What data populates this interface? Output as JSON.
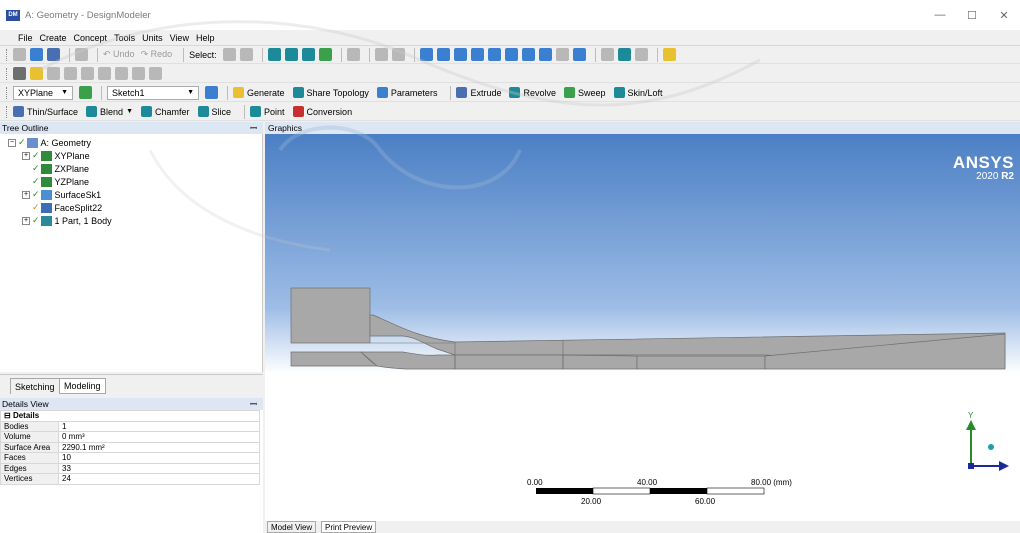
{
  "window": {
    "title": "A: Geometry - DesignModeler",
    "logo_text": "DM",
    "controls": [
      "—",
      "☐",
      "✕"
    ]
  },
  "menu": [
    "File",
    "Create",
    "Concept",
    "Tools",
    "Units",
    "View",
    "Help"
  ],
  "toolbar1": {
    "undo_label": "Undo",
    "redo_label": "Redo",
    "select_label": "Select:"
  },
  "toolbar3": {
    "plane_value": "XYPlane",
    "sketch_value": "Sketch1",
    "generate_label": "Generate",
    "share_topology_label": "Share Topology",
    "parameters_label": "Parameters",
    "extrude_label": "Extrude",
    "revolve_label": "Revolve",
    "sweep_label": "Sweep",
    "skinloft_label": "Skin/Loft"
  },
  "toolbar4": {
    "thinsurface_label": "Thin/Surface",
    "blend_label": "Blend",
    "chamfer_label": "Chamfer",
    "slice_label": "Slice",
    "point_label": "Point",
    "conversion_label": "Conversion"
  },
  "tree": {
    "header": "Tree Outline",
    "pin": "ꟷ",
    "items": [
      {
        "label": "A: Geometry",
        "icon": "geometry-icon"
      },
      {
        "label": "XYPlane",
        "icon": "plane-icon"
      },
      {
        "label": "ZXPlane",
        "icon": "plane-icon"
      },
      {
        "label": "YZPlane",
        "icon": "plane-icon"
      },
      {
        "label": "SurfaceSk1",
        "icon": "surface-sketch-icon"
      },
      {
        "label": "FaceSplit22",
        "icon": "face-split-icon"
      },
      {
        "label": "1 Part, 1 Body",
        "icon": "part-body-icon"
      }
    ]
  },
  "panel_tabs": [
    "Sketching",
    "Modeling"
  ],
  "details": {
    "header": "Details View",
    "section": "Details",
    "rows": [
      {
        "key": "Bodies",
        "value": "1"
      },
      {
        "key": "Volume",
        "value": "0 mm³"
      },
      {
        "key": "Surface Area",
        "value": "2290.1 mm²"
      },
      {
        "key": "Faces",
        "value": "10"
      },
      {
        "key": "Edges",
        "value": "33"
      },
      {
        "key": "Vertices",
        "value": "24"
      }
    ]
  },
  "graphics": {
    "header": "Graphics",
    "brand": "ANSYS",
    "version_prefix": "2020",
    "version_suffix": "R2",
    "axis_label": "Y",
    "scale_top": [
      "0.00",
      "40.00",
      "80.00 (mm)"
    ],
    "scale_bottom": [
      "20.00",
      "60.00"
    ]
  },
  "bottom_tabs": [
    "Model View",
    "Print Preview"
  ],
  "colors": {
    "graphics_top": "#4b7fc4",
    "body_fill": "#a8a8a8",
    "panel_header": "#dde6f3"
  }
}
